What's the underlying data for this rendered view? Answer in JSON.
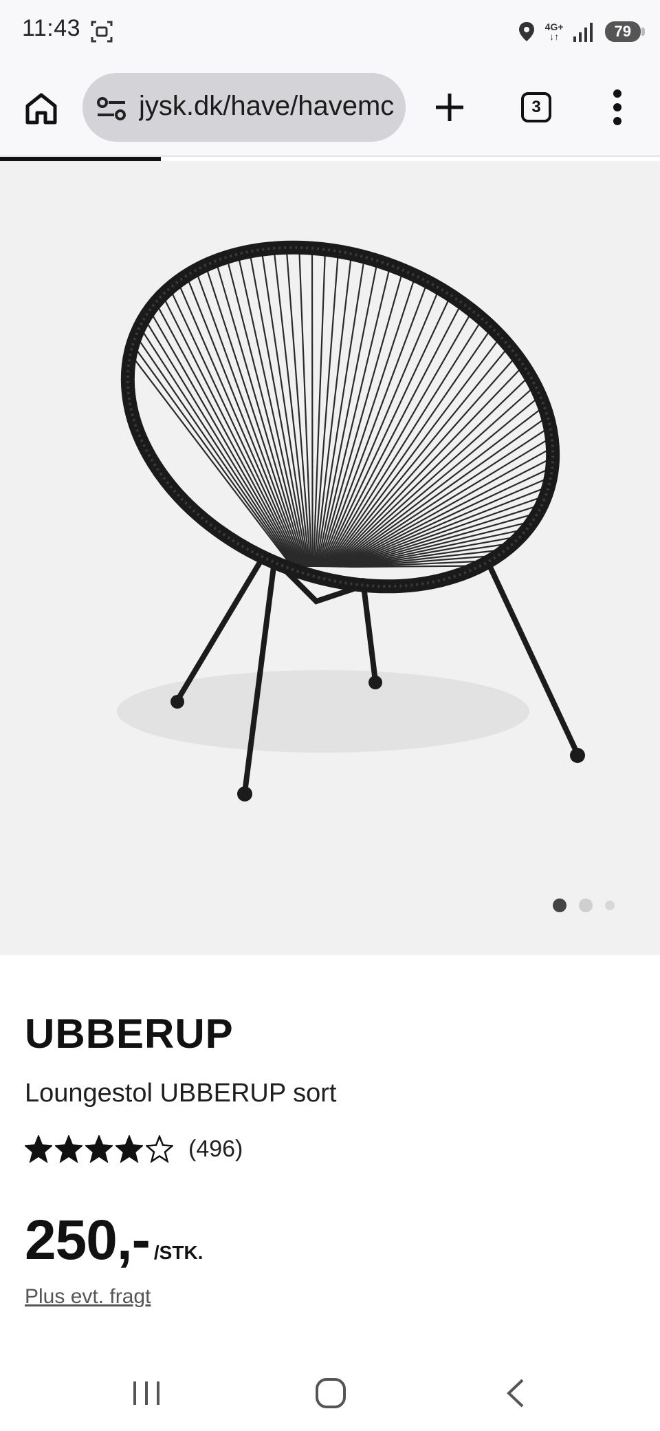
{
  "status_bar": {
    "time": "11:43",
    "network": "4G+",
    "battery": "79",
    "icons": [
      "screenshot-icon",
      "location-icon",
      "signal-icon",
      "battery-icon"
    ]
  },
  "browser": {
    "url": "jysk.dk/have/havemc",
    "tab_count": "3",
    "icons": [
      "home-icon",
      "site-settings-icon",
      "new-tab-icon",
      "tab-switcher-icon",
      "more-menu-icon"
    ]
  },
  "gallery": {
    "image_alt": "Loungestol UBBERUP sort",
    "total_images": 3,
    "active_index": 0
  },
  "product": {
    "brand": "UBBERUP",
    "name": "Loungestol UBBERUP sort",
    "rating": 4.5,
    "rating_max": 5,
    "review_count": "(496)",
    "price": "250,-",
    "price_unit": "/STK.",
    "shipping_text": "Plus evt. fragt"
  },
  "colors": {
    "text": "#111111",
    "image_background": "#f1f1f1",
    "url_pill": "#d3d3d8",
    "toolbar": "#f8f8fb"
  },
  "nav": {
    "icons": [
      "recent-apps-icon",
      "home-nav-icon",
      "back-icon"
    ]
  }
}
